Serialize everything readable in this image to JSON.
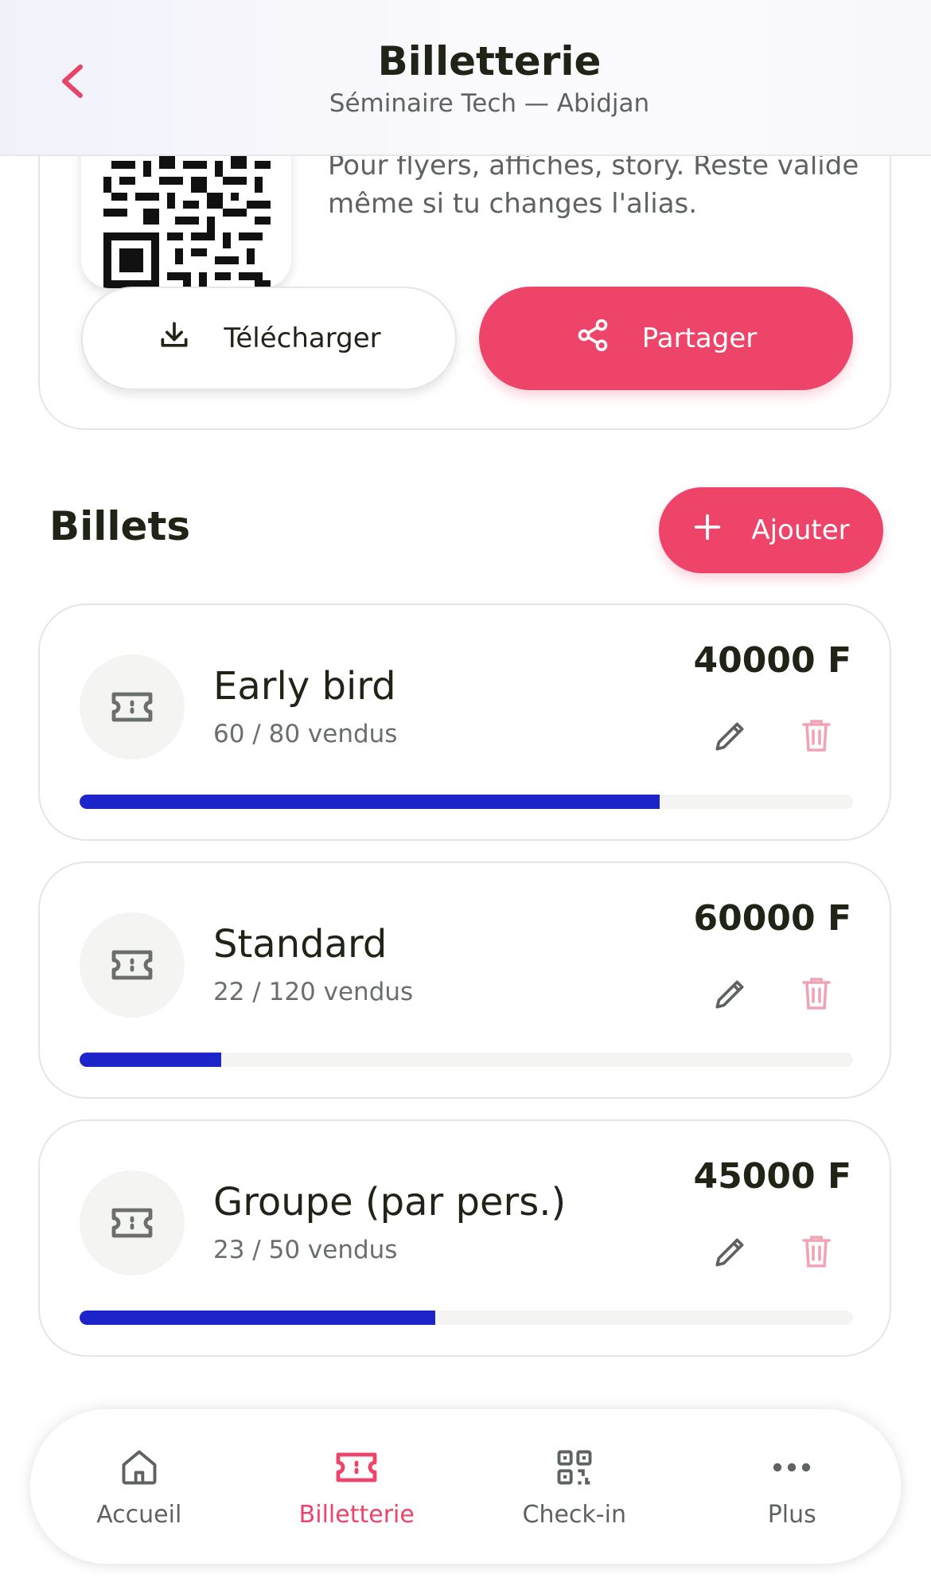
{
  "header": {
    "title": "Billetterie",
    "subtitle": "Séminaire Tech — Abidjan"
  },
  "share": {
    "description_partial": "Pour flyers, affiches, story. Reste valide même si tu changes l'alias.",
    "download_label": "Télécharger",
    "share_label": "Partager"
  },
  "tickets_section": {
    "title": "Billets",
    "add_label": "Ajouter",
    "items": [
      {
        "name": "Early bird",
        "sold_text": "60 / 80 vendus",
        "price": "40000 F",
        "sold": 60,
        "total": 80
      },
      {
        "name": "Standard",
        "sold_text": "22 / 120 vendus",
        "price": "60000 F",
        "sold": 22,
        "total": 120
      },
      {
        "name": "Groupe (par pers.)",
        "sold_text": "23 / 50 vendus",
        "price": "45000 F",
        "sold": 23,
        "total": 50
      }
    ]
  },
  "bottom_nav": {
    "items": [
      {
        "label": "Accueil",
        "icon": "home-icon",
        "active": false
      },
      {
        "label": "Billetterie",
        "icon": "ticket-icon",
        "active": true
      },
      {
        "label": "Check-in",
        "icon": "qr-icon",
        "active": false
      },
      {
        "label": "Plus",
        "icon": "more-icon",
        "active": false
      }
    ]
  },
  "colors": {
    "accent": "#ee4469",
    "progress": "#1d24c9",
    "text": "#1f2417",
    "muted": "#5f6360"
  }
}
